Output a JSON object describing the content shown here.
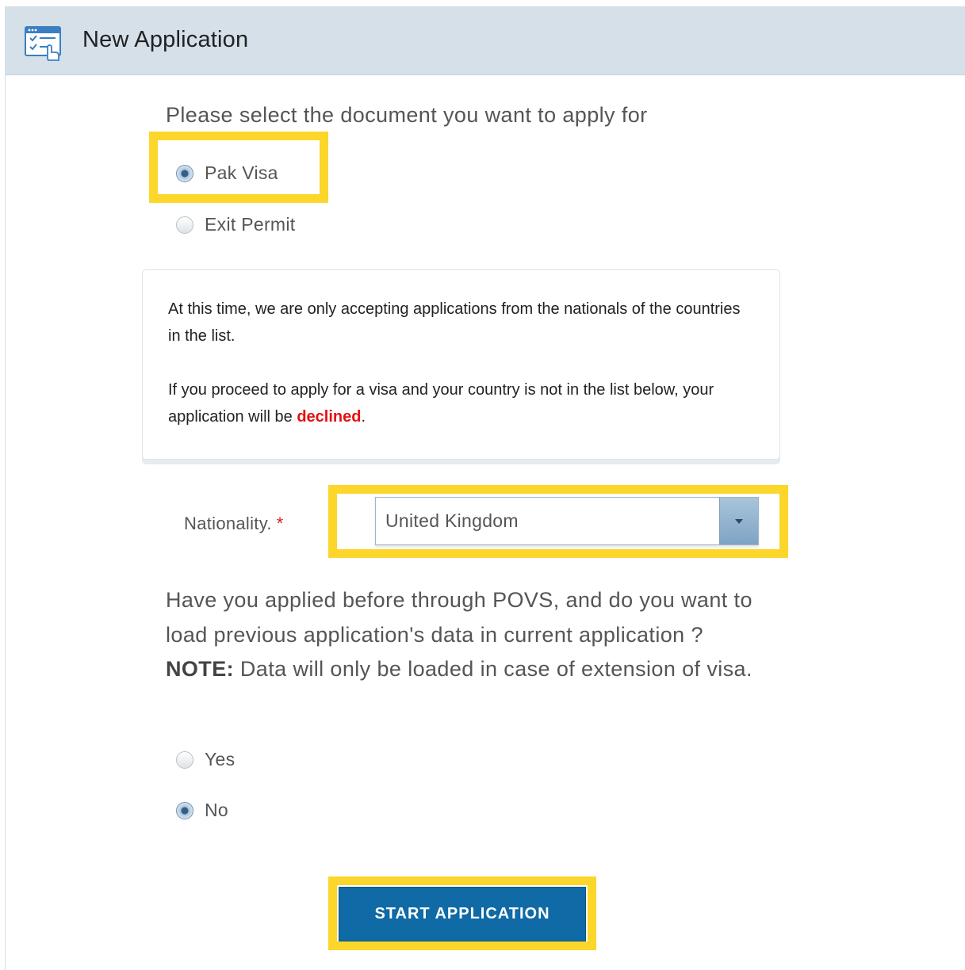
{
  "header": {
    "title": "New Application",
    "icon": "application-form-icon"
  },
  "document_select": {
    "prompt": "Please select the document you want to apply for",
    "options": [
      {
        "label": "Pak Visa",
        "checked": true
      },
      {
        "label": "Exit Permit",
        "checked": false
      }
    ]
  },
  "notice": {
    "paragraph1": "At this time, we are only accepting applications from the nationals of the countries in the list.",
    "paragraph2_prefix": "If you proceed to apply for a visa and your country is not in the list below, your application will be ",
    "paragraph2_emphasis": "declined",
    "paragraph2_suffix": "."
  },
  "nationality": {
    "label": "Nationality.",
    "required_mark": "*",
    "selected_value": "United Kingdom"
  },
  "previous_application": {
    "question_prefix": "Have you applied before through POVS, and do you want to load previous application's data in current application ?",
    "note_label": "NOTE:",
    "note_text": "Data will only be loaded in case of extension of visa.",
    "options": [
      {
        "label": "Yes",
        "checked": false
      },
      {
        "label": "No",
        "checked": true
      }
    ]
  },
  "actions": {
    "start_label": "START APPLICATION"
  },
  "colors": {
    "header_bg": "#d5e0e8",
    "highlight": "#fcd62a",
    "primary_button": "#0f6aa6",
    "declined": "#e41010"
  }
}
